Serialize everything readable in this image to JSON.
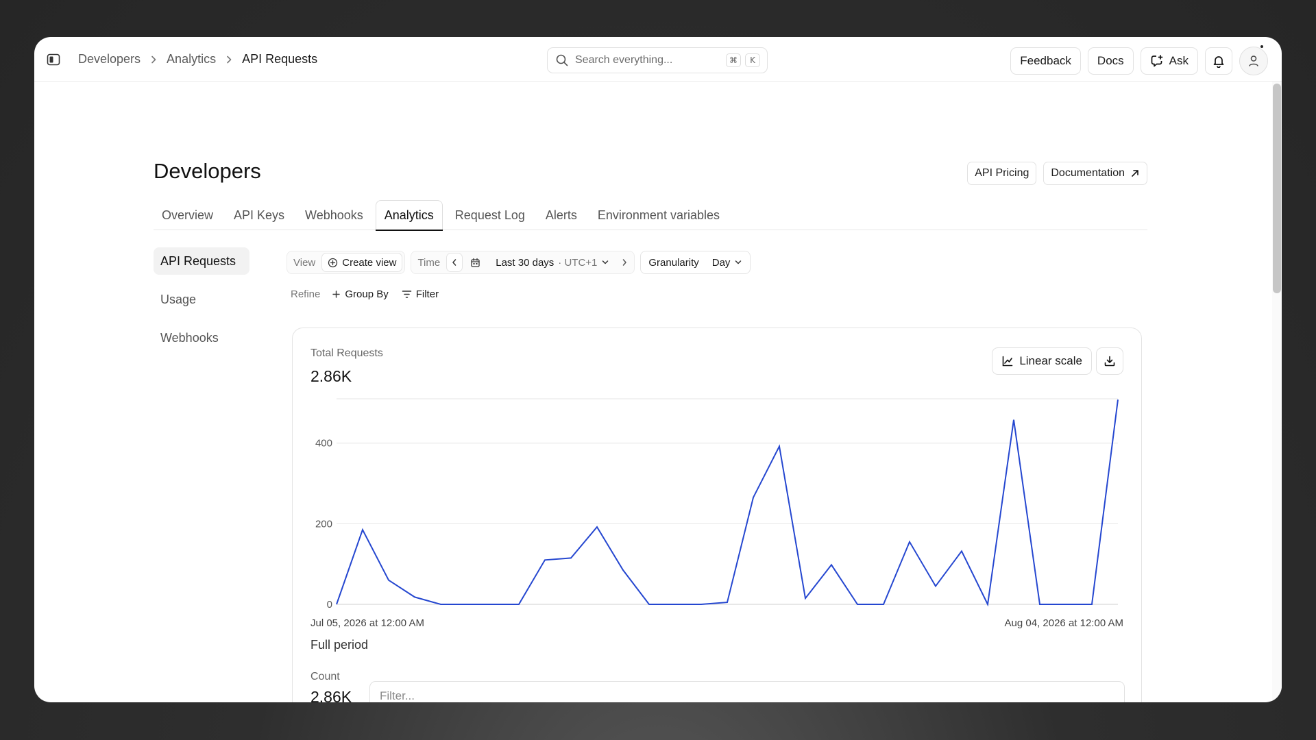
{
  "breadcrumb": [
    "Developers",
    "Analytics",
    "API Requests"
  ],
  "search": {
    "placeholder": "Search everything...",
    "kbd1": "⌘",
    "kbd2": "K"
  },
  "top_actions": {
    "feedback": "Feedback",
    "docs": "Docs",
    "ask": "Ask"
  },
  "page": {
    "title": "Developers",
    "api_pricing": "API Pricing",
    "documentation": "Documentation"
  },
  "tabs": [
    {
      "label": "Overview",
      "active": false
    },
    {
      "label": "API Keys",
      "active": false
    },
    {
      "label": "Webhooks",
      "active": false
    },
    {
      "label": "Analytics",
      "active": true
    },
    {
      "label": "Request Log",
      "active": false
    },
    {
      "label": "Alerts",
      "active": false
    },
    {
      "label": "Environment variables",
      "active": false
    }
  ],
  "subnav": [
    {
      "label": "API Requests",
      "active": true
    },
    {
      "label": "Usage",
      "active": false
    },
    {
      "label": "Webhooks",
      "active": false
    }
  ],
  "toolbar": {
    "view_label": "View",
    "create_view": "Create view",
    "time_label": "Time",
    "range": "Last 30 days",
    "timezone": "· UTC+1",
    "granularity_label": "Granularity",
    "granularity_value": "Day",
    "refine_label": "Refine",
    "group_by": "Group By",
    "filter": "Filter"
  },
  "card": {
    "label": "Total Requests",
    "value": "2.86K",
    "scale_button": "Linear scale",
    "start_date": "Jul 05, 2026 at 12:00 AM",
    "end_date": "Aug 04, 2026 at 12:00 AM",
    "period": "Full period",
    "count_label": "Count",
    "count_value": "2.86K",
    "filter_placeholder": "Filter..."
  },
  "chart_data": {
    "type": "line",
    "title": "Total Requests",
    "x_start": "Jul 05, 2026 at 12:00 AM",
    "x_end": "Aug 04, 2026 at 12:00 AM",
    "y_ticks": [
      0,
      200,
      400
    ],
    "ylim": [
      0,
      510
    ],
    "grid": true,
    "line_color": "#2547d0",
    "series": [
      {
        "values": [
          0,
          185,
          60,
          18,
          0,
          0,
          0,
          0,
          110,
          115,
          192,
          85,
          0,
          0,
          0,
          5,
          265,
          392,
          15,
          98,
          0,
          0,
          155,
          45,
          132,
          0,
          458,
          0,
          0,
          0,
          508
        ]
      }
    ]
  },
  "colors": {
    "accent_line": "#2547d0",
    "active_tab_underline": "#111111"
  }
}
